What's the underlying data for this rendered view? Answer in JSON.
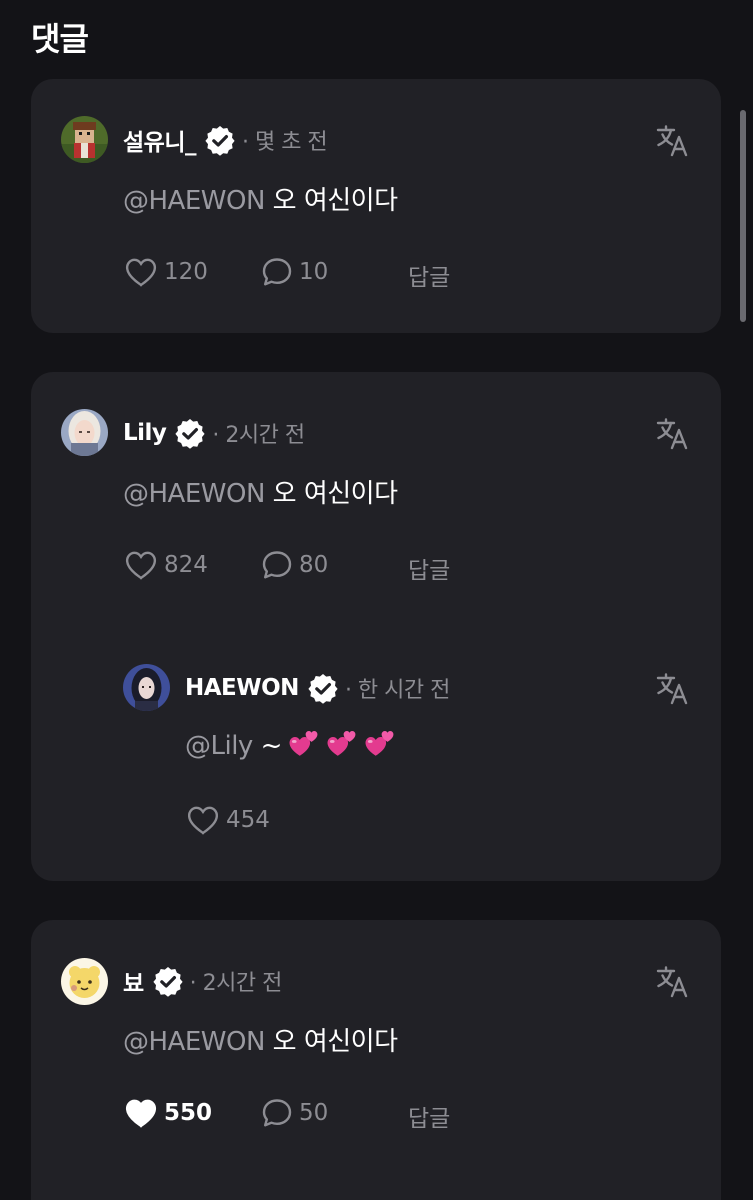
{
  "page": {
    "title": "댓글"
  },
  "colors": {
    "background": "#131317",
    "card": "#212126",
    "muted": "#8d8d93",
    "text": "#ffffff"
  },
  "comments": [
    {
      "username": "설유니_",
      "meta": "· 몇 초 전",
      "mention": "@HAEWON",
      "text": " 오 여신이다",
      "likes": "120",
      "replies": "10",
      "reply_label": "답글",
      "liked": false
    },
    {
      "username": "Lily",
      "meta": "· 2시간 전",
      "mention": "@HAEWON",
      "text": " 오 여신이다",
      "likes": "824",
      "replies": "80",
      "reply_label": "답글",
      "liked": false,
      "reply": {
        "username": "HAEWON",
        "meta": "· 한 시간 전",
        "mention": "@Lily",
        "text": " ~",
        "emoji": "two-hearts",
        "emoji_count": 3,
        "likes": "454"
      }
    },
    {
      "username": "뵤",
      "meta": "· 2시간 전",
      "mention": "@HAEWON",
      "text": " 오 여신이다",
      "likes": "550",
      "replies": "50",
      "reply_label": "답글",
      "liked": true
    }
  ],
  "icons": {
    "verified": "verified-badge-icon",
    "translate": "translate-icon",
    "like": "heart-icon",
    "comment": "speech-bubble-icon"
  }
}
